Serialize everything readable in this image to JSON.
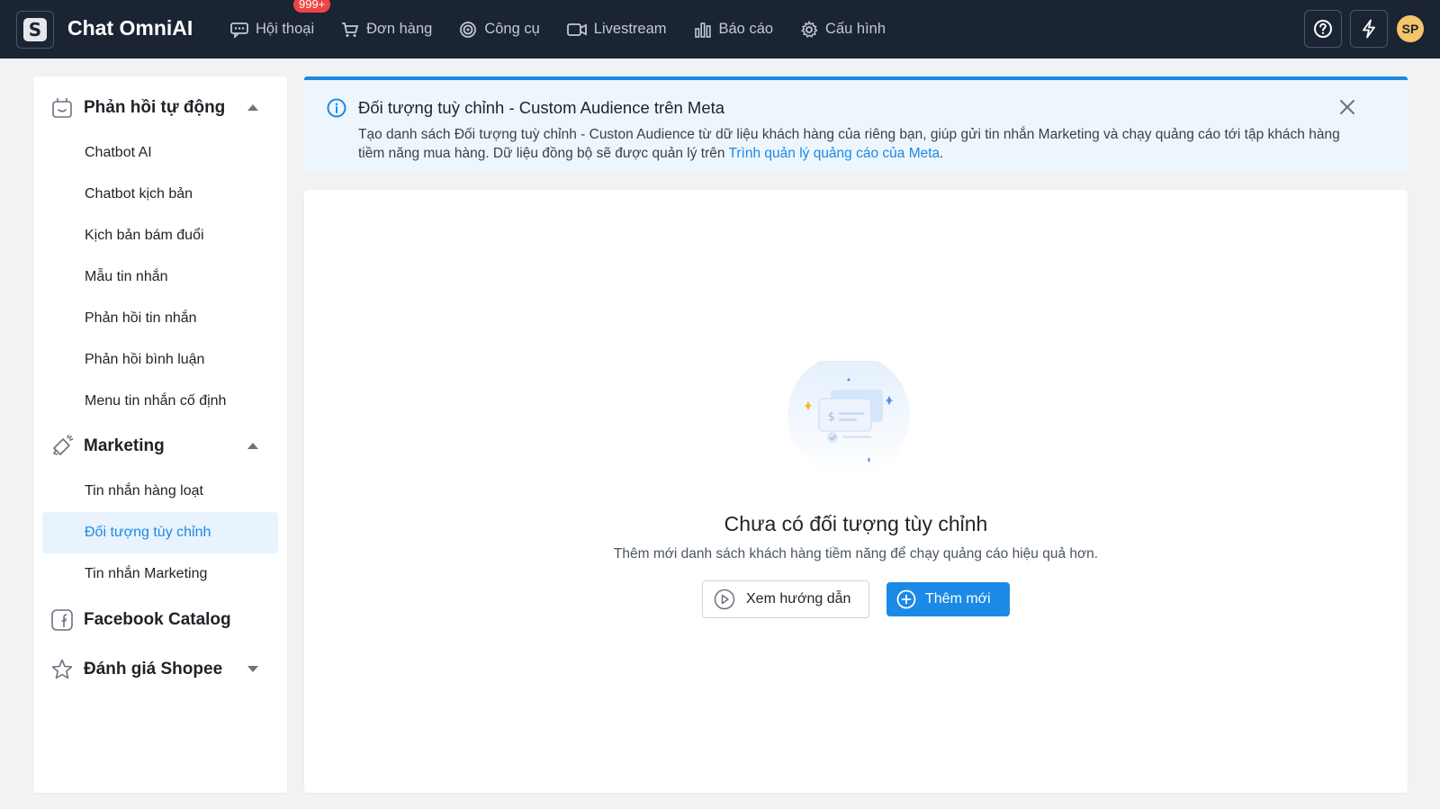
{
  "app": {
    "brand": "Chat OmniAI",
    "logo_letter": "S"
  },
  "nav": {
    "items": [
      {
        "label": "Hội thoại",
        "icon": "chat-icon",
        "badge": "999+"
      },
      {
        "label": "Đơn hàng",
        "icon": "cart-icon"
      },
      {
        "label": "Công cụ",
        "icon": "tools-icon"
      },
      {
        "label": "Livestream",
        "icon": "video-icon"
      },
      {
        "label": "Báo cáo",
        "icon": "bar-chart-icon"
      },
      {
        "label": "Cấu hình",
        "icon": "gear-icon"
      }
    ],
    "right": {
      "help_icon": "help-icon",
      "flash_icon": "lightning-icon",
      "avatar_initials": "SP"
    }
  },
  "sidebar": {
    "sections": [
      {
        "label": "Phản hồi tự động",
        "icon": "robot-icon",
        "expanded": true,
        "items": [
          "Chatbot AI",
          "Chatbot kịch bản",
          "Kịch bản bám đuổi",
          "Mẫu tin nhắn",
          "Phản hồi tin nhắn",
          "Phản hồi bình luận",
          "Menu tin nhắn cố định"
        ]
      },
      {
        "label": "Marketing",
        "icon": "megaphone-icon",
        "expanded": true,
        "items": [
          "Tin nhắn hàng loạt",
          "Đối tượng tùy chỉnh",
          "Tin nhắn Marketing"
        ],
        "active_item": "Đối tượng tùy chỉnh"
      },
      {
        "label": "Facebook Catalog",
        "icon": "facebook-icon"
      },
      {
        "label": "Đánh giá Shopee",
        "icon": "star-icon",
        "expanded": false
      }
    ]
  },
  "banner": {
    "title": "Đối tượng tuỳ chỉnh - Custom Audience trên Meta",
    "desc_part1": "Tạo danh sách Đối tượng tuỳ chỉnh - Custon Audience từ dữ liệu khách hàng của riêng bạn, giúp gửi tin nhắn Marketing và chạy quảng cáo tới tập khách hàng tiềm năng mua hàng. Dữ liệu đồng bộ sẽ được quản lý trên ",
    "link": "Trình quản lý quảng cáo của Meta",
    "desc_end": "."
  },
  "empty_state": {
    "title": "Chưa có đối tượng tùy chỉnh",
    "description": "Thêm mới danh sách khách hàng tiềm năng để chạy quảng cáo hiệu quả hơn.",
    "guide_button": "Xem hướng dẫn",
    "add_button": "Thêm mới"
  },
  "colors": {
    "topbar": "#1b2433",
    "accent": "#1a8ae6",
    "badge": "#ef4444",
    "active_bg": "#e8f3fd"
  }
}
